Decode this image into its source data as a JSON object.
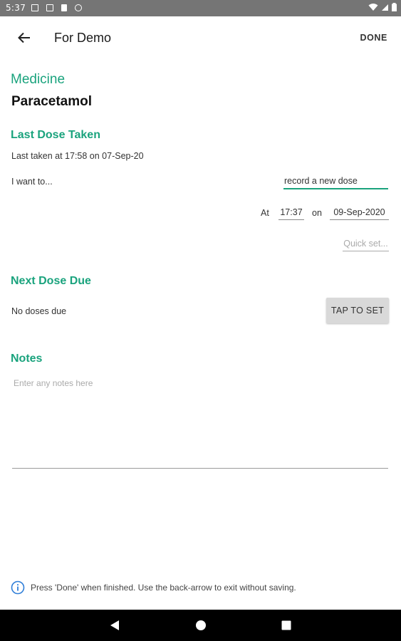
{
  "status_bar": {
    "time": "5:37",
    "notification_icons": [
      "message-icon",
      "message-icon",
      "clipboard-icon",
      "sync-icon"
    ],
    "status_icons": [
      "wifi-icon",
      "signal-icon",
      "battery-icon"
    ]
  },
  "app_bar": {
    "title": "For Demo",
    "done_label": "DONE",
    "back_icon": "arrow-left-icon"
  },
  "medicine": {
    "section_title": "Medicine",
    "name": "Paracetamol"
  },
  "last_dose": {
    "section_title": "Last Dose Taken",
    "last_taken_text": "Last taken at 17:58 on 07-Sep-20",
    "i_want_label": "I want to...",
    "action_value": "record a new dose",
    "at_label": "At",
    "time_value": "17:37",
    "on_label": "on",
    "date_value": "09-Sep-2020",
    "quick_set_placeholder": "Quick set..."
  },
  "next_dose": {
    "section_title": "Next Dose Due",
    "status_text": "No doses due",
    "tap_to_set_label": "TAP TO SET"
  },
  "notes": {
    "section_title": "Notes",
    "placeholder": "Enter any notes here",
    "value": ""
  },
  "footer": {
    "hint_icon": "info-icon",
    "hint_text": "Press 'Done' when finished.  Use the back-arrow to exit without saving."
  },
  "colors": {
    "accent": "#1aa37d",
    "status_bar": "#757575",
    "nav_bar": "#000000"
  }
}
